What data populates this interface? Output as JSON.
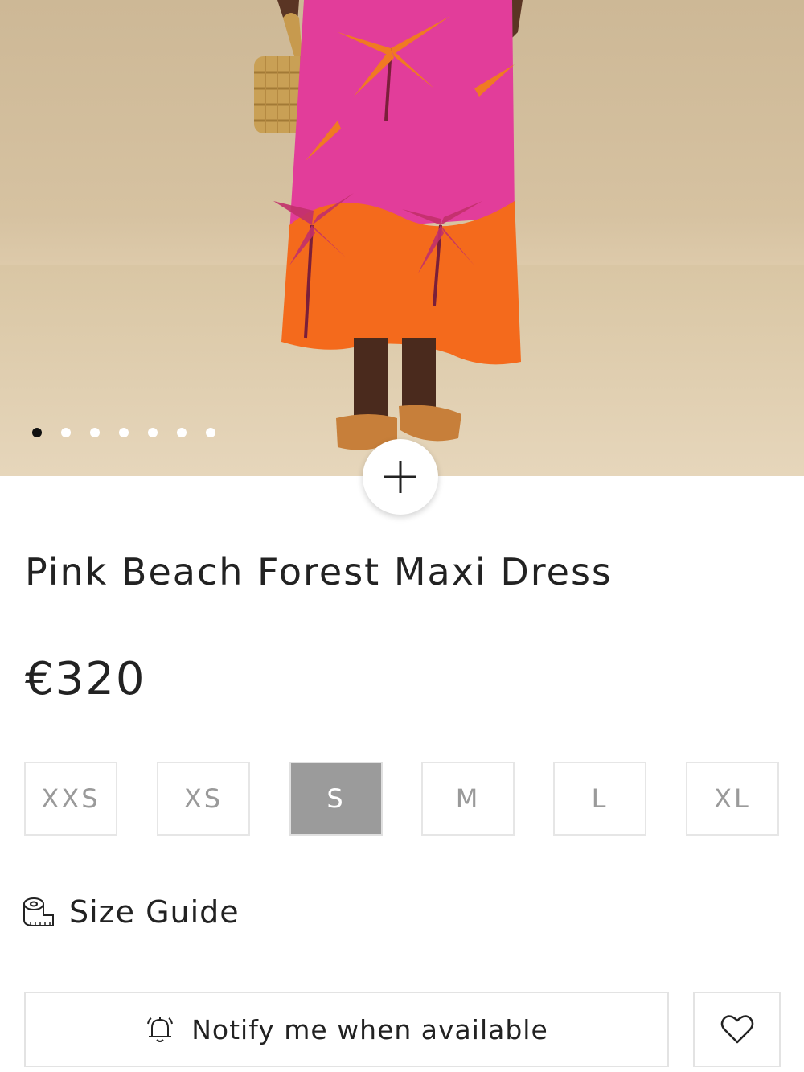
{
  "product": {
    "image_alt": "Model wearing pink and orange palm tree print maxi dress with woven basket bag and sandals",
    "carousel": {
      "total": 7,
      "active_index": 0
    },
    "title": "Pink Beach Forest Maxi Dress",
    "price": "€320"
  },
  "sizes": [
    {
      "label": "XXS",
      "selected": false
    },
    {
      "label": "XS",
      "selected": false
    },
    {
      "label": "S",
      "selected": true
    },
    {
      "label": "M",
      "selected": false
    },
    {
      "label": "L",
      "selected": false
    },
    {
      "label": "XL",
      "selected": false
    }
  ],
  "size_guide": {
    "label": "Size Guide",
    "icon": "measuring-tape-icon"
  },
  "actions": {
    "notify_label": "Notify me when available",
    "notify_icon": "bell-icon",
    "wishlist_icon": "heart-icon"
  },
  "colors": {
    "dress_pink": "#e23d9a",
    "dress_orange": "#f46a1c",
    "selected_size_bg": "#9b9b9b"
  }
}
